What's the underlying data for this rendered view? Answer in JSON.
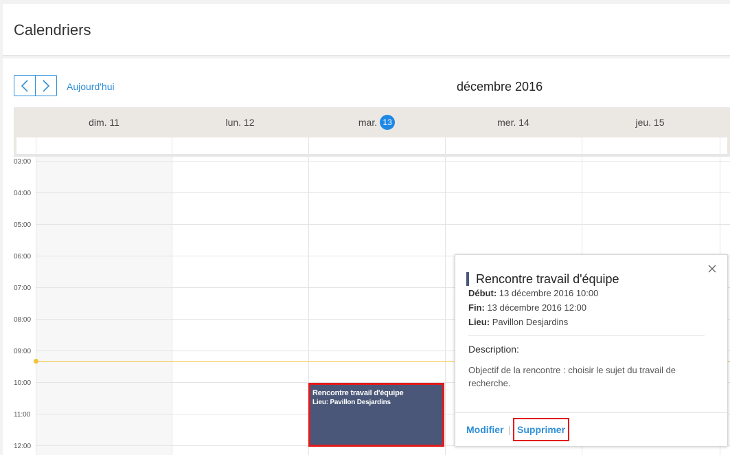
{
  "page": {
    "title": "Calendriers"
  },
  "toolbar": {
    "today_label": "Aujourd'hui",
    "month_label": "décembre 2016"
  },
  "days": [
    {
      "label": "dim. 11"
    },
    {
      "label": "lun. 12"
    },
    {
      "label": "mar.",
      "badge": "13"
    },
    {
      "label": "mer. 14"
    },
    {
      "label": "jeu. 15"
    }
  ],
  "hours": [
    "03:00",
    "04:00",
    "05:00",
    "06:00",
    "07:00",
    "08:00",
    "09:00",
    "10:00",
    "11:00",
    "12:00"
  ],
  "event": {
    "title": "Rencontre travail d'équipe",
    "location_line": "Lieu: Pavillon Desjardins"
  },
  "popover": {
    "title": "Rencontre travail d'équipe",
    "start_label": "Début:",
    "start_value": "13 décembre 2016 10:00",
    "end_label": "Fin:",
    "end_value": "13 décembre 2016 12:00",
    "location_label": "Lieu:",
    "location_value": "Pavillon Desjardins",
    "description_label": "Description:",
    "description_text": "Objectif de la rencontre : choisir le sujet du travail de recherche.",
    "modify_label": "Modifier",
    "separator": "|",
    "delete_label": "Supprimer"
  },
  "colors": {
    "accent": "#2e8fd8",
    "event_bg": "#4a5778",
    "now_line": "#f2c23a",
    "highlight": "#e21c1c"
  }
}
